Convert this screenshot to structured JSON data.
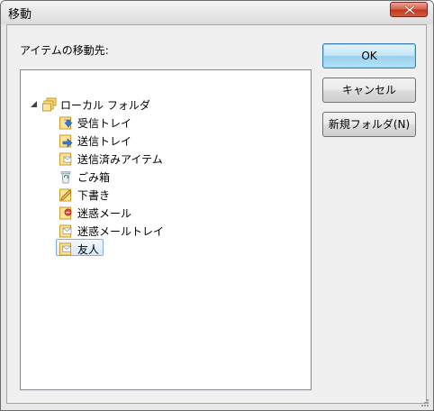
{
  "dialog": {
    "title": "移動",
    "destination_label": "アイテムの移動先:"
  },
  "tree": {
    "root": {
      "label": "ローカル フォルダ",
      "icon": "local-folders-icon",
      "expanded": true
    },
    "children": [
      {
        "label": "受信トレイ",
        "icon": "inbox-icon"
      },
      {
        "label": "送信トレイ",
        "icon": "outbox-icon"
      },
      {
        "label": "送信済みアイテム",
        "icon": "sent-items-icon"
      },
      {
        "label": "ごみ箱",
        "icon": "trash-icon"
      },
      {
        "label": "下書き",
        "icon": "drafts-icon"
      },
      {
        "label": "迷惑メール",
        "icon": "junk-mail-icon"
      },
      {
        "label": "迷惑メールトレイ",
        "icon": "junk-mail-tray-icon"
      },
      {
        "label": "友人",
        "icon": "custom-folder-icon",
        "selected": true
      }
    ]
  },
  "buttons": {
    "ok": "OK",
    "cancel": "キャンセル",
    "new_folder": "新規フォルダ(N)"
  },
  "colors": {
    "accent": "#3c7fb1",
    "selection": "#dceafa",
    "close_button": "#c2391f"
  }
}
